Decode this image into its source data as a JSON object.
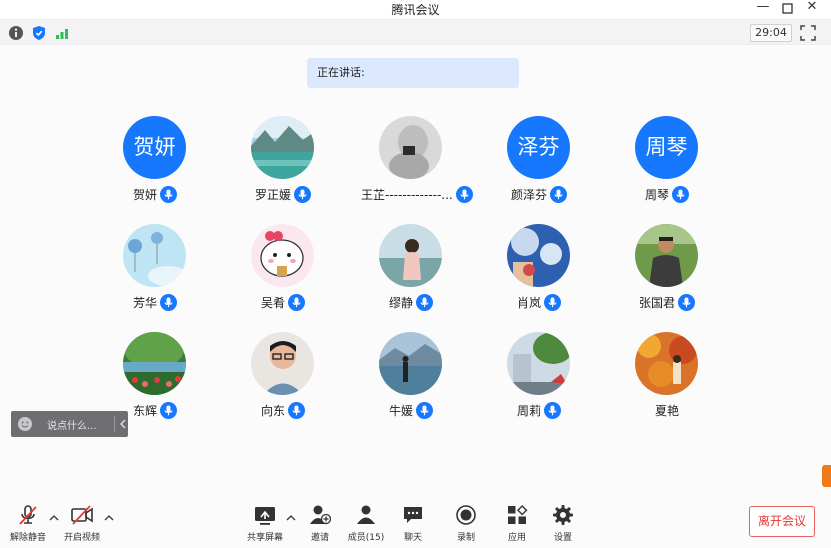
{
  "window": {
    "title": "腾讯会议",
    "controls": [
      "minimize-icon",
      "maximize-icon",
      "close-icon"
    ]
  },
  "infobar": {
    "icons": [
      "info-icon",
      "shield-icon",
      "signal-icon"
    ],
    "timer": "29:04"
  },
  "speaking_label": "正在讲话:",
  "participants": [
    {
      "name": "贺妍",
      "avatar_text": "贺妍",
      "avatar_color": "#1677ff"
    },
    {
      "name": "罗正媛",
      "avatar_text": ""
    },
    {
      "name": "王芷-------------...",
      "avatar_text": ""
    },
    {
      "name": "颜泽芬",
      "avatar_text": "泽芬",
      "avatar_color": "#1677ff"
    },
    {
      "name": "周琴",
      "avatar_text": "周琴",
      "avatar_color": "#1677ff"
    },
    {
      "name": "芳华",
      "avatar_text": ""
    },
    {
      "name": "吴肴",
      "avatar_text": ""
    },
    {
      "name": "缪静",
      "avatar_text": ""
    },
    {
      "name": "肖岚",
      "avatar_text": ""
    },
    {
      "name": "张国君",
      "avatar_text": ""
    },
    {
      "name": "东辉",
      "avatar_text": ""
    },
    {
      "name": "向东",
      "avatar_text": ""
    },
    {
      "name": "牛媛",
      "avatar_text": ""
    },
    {
      "name": "周莉",
      "avatar_text": ""
    },
    {
      "name": "夏艳",
      "avatar_text": ""
    }
  ],
  "chat": {
    "placeholder": "说点什么..."
  },
  "toolbar": {
    "unmute": "解除静音",
    "start_video": "开启视频",
    "share_screen": "共享屏幕",
    "invite": "邀请",
    "members": "成员(15)",
    "chat": "聊天",
    "record": "录制",
    "apps": "应用",
    "settings": "设置",
    "leave": "离开会议"
  },
  "colors": {
    "accent": "#1677ff",
    "leave": "#e53935",
    "speaking_bg": "#dbe8fd"
  }
}
